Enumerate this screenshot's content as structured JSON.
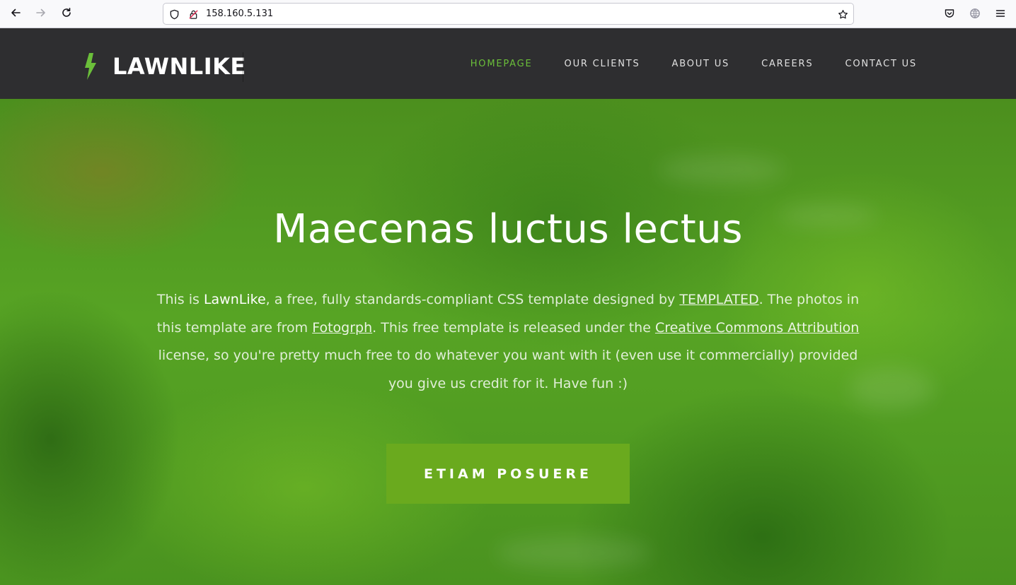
{
  "browser": {
    "url": "158.160.5.131",
    "icons": {
      "back": "back-arrow-icon",
      "forward": "forward-arrow-icon",
      "reload": "reload-icon",
      "shield": "tracking-protection-shield-icon",
      "lock": "insecure-lock-icon",
      "bookmark": "bookmark-star-icon",
      "pocket": "pocket-icon",
      "extensions": "globe-icon",
      "menu": "hamburger-menu-icon"
    }
  },
  "site": {
    "logo_text": "LAWNLIKE",
    "logo_icon": "lightning-bolt-icon",
    "accent_color": "#6bbf3a",
    "nav": [
      {
        "label": "HOMEPAGE",
        "active": true
      },
      {
        "label": "OUR CLIENTS",
        "active": false
      },
      {
        "label": "ABOUT US",
        "active": false
      },
      {
        "label": "CAREERS",
        "active": false
      },
      {
        "label": "CONTACT US",
        "active": false
      }
    ]
  },
  "hero": {
    "title": "Maecenas luctus lectus",
    "text": {
      "part1": "This is ",
      "brand": "LawnLike",
      "part2": ", a free, fully standards-compliant CSS template designed by ",
      "link1": "TEMPLATED",
      "part3": ". The photos in this template are from ",
      "link2": "Fotogrph",
      "part4": ". This free template is released under the ",
      "link3": "Creative Commons Attribution",
      "part5": " license, so you're pretty much free to do whatever you want with it (even use it commercially) provided you give us credit for it. Have fun :)"
    },
    "button_label": "ETIAM POSUERE",
    "button_color": "#6aaa1e"
  }
}
